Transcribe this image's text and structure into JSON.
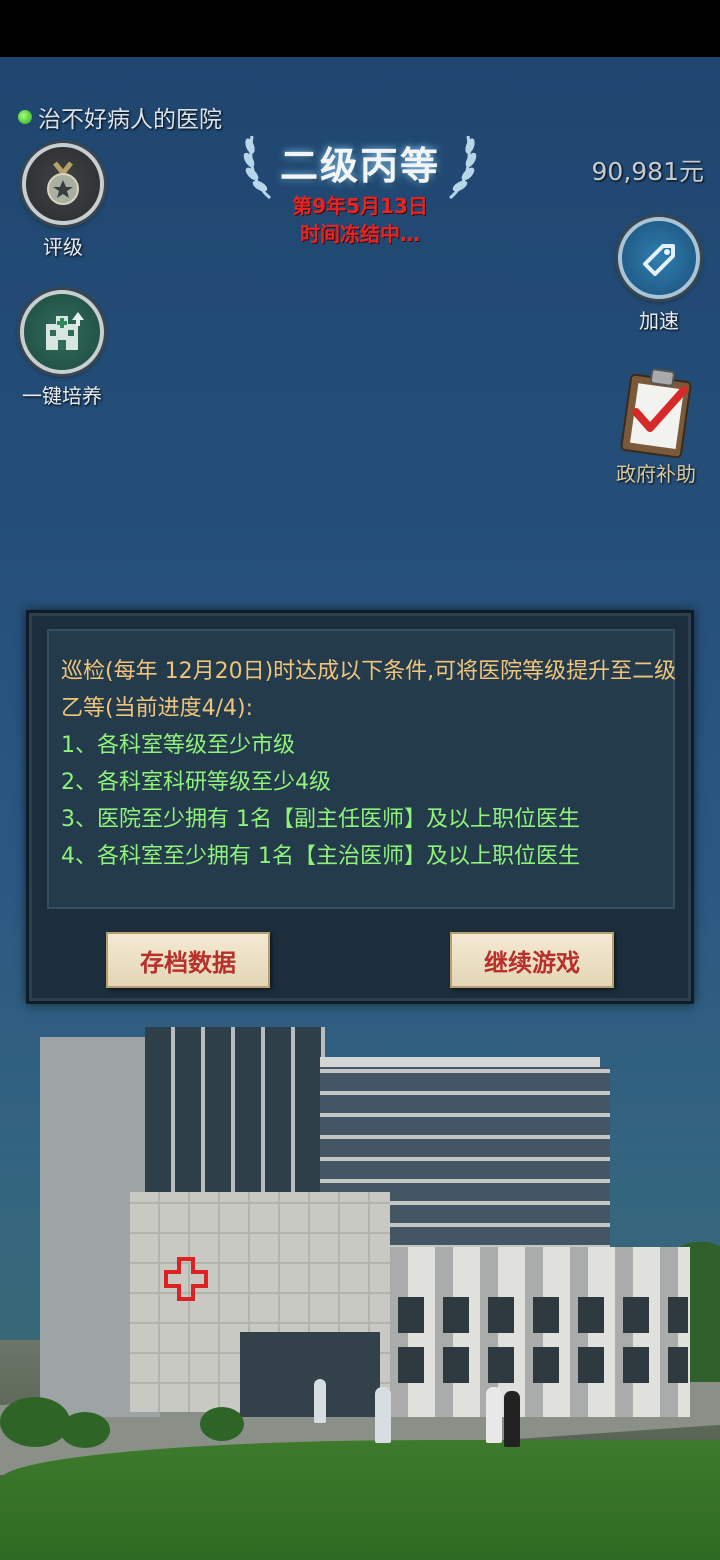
{
  "hud": {
    "hospital_name": "治不好病人的医院",
    "rating_label": "评级",
    "train_label": "一键培养",
    "speed_label": "加速",
    "subsidy_label": "政府补助",
    "grade": "二级丙等",
    "date": "第9年5月13日",
    "status": "时间冻结中…",
    "money": "90,981元"
  },
  "dialog": {
    "intro": "巡检(每年 12月20日)时达成以下条件,可将医院等级提升至二级乙等(当前进度4/4):",
    "conditions": [
      "1、各科室等级至少市级",
      "2、各科室科研等级至少4级",
      "3、医院至少拥有 1名【副主任医师】及以上职位医生",
      "4、各科室至少拥有 1名【主治医师】及以上职位医生"
    ],
    "save_label": "存档数据",
    "continue_label": "继续游戏"
  },
  "colors": {
    "sky": "#244e79",
    "date_red": "#e42525",
    "intro_orange": "#f0c47c",
    "condition_green": "#8ff27a",
    "button_text": "#b8302a"
  },
  "icons": [
    "medal-icon",
    "hospital-upgrade-icon",
    "speed-tag-icon",
    "clipboard-check-icon",
    "laurel-icon",
    "status-dot-icon"
  ]
}
